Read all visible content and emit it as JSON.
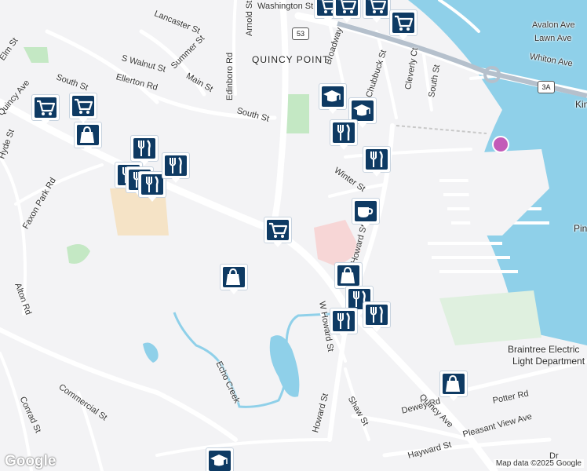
{
  "map": {
    "neighborhood": "QUINCY POINT",
    "route_shields": [
      "53",
      "3A"
    ],
    "streets": [
      "Washington St",
      "Lancaster St",
      "Arnold St",
      "Avalon Ave",
      "Lawn Ave",
      "Whiton Ave",
      "Summer St",
      "S Walnut St",
      "Ellerton Rd",
      "Main St",
      "Edinboro Rd",
      "Broadway",
      "Chubbuck St",
      "Cleverly Ct",
      "South St",
      "South St",
      "South St",
      "Elm St",
      "Quincy Ave",
      "Hyde St",
      "Faxon Park Rd",
      "Winter St",
      "Howard St",
      "W Howard St",
      "Alton Rd",
      "Echo Creek",
      "Commercial St",
      "Conrad St",
      "Shaw St",
      "Howard St",
      "Dewey Rd",
      "Quincy Ave",
      "Potter Rd",
      "Pleasant View Ave",
      "Hayward St",
      "Dr",
      "Kin",
      "Pin"
    ],
    "places": [
      "Braintree Electric",
      "Light Department"
    ],
    "water_color": "#8fd0e9",
    "road_color": "#ffffff",
    "land_color": "#f3f3f5",
    "park_color": "#c4e8c4",
    "marker_color": "#0e3a63"
  },
  "markers": [
    {
      "icon": "shopping-cart-icon"
    },
    {
      "icon": "shopping-cart-icon"
    },
    {
      "icon": "shopping-cart-icon"
    },
    {
      "icon": "shopping-cart-icon"
    },
    {
      "icon": "shopping-cart-icon"
    },
    {
      "icon": "shopping-bag-icon"
    },
    {
      "icon": "shopping-cart-icon"
    },
    {
      "icon": "restaurant-icon"
    },
    {
      "icon": "restaurant-icon"
    },
    {
      "icon": "restaurant-icon"
    },
    {
      "icon": "restaurant-icon"
    },
    {
      "icon": "shopping-cart-icon"
    },
    {
      "icon": "restaurant-icon"
    },
    {
      "icon": "shopping-bag-icon"
    },
    {
      "icon": "school-icon"
    },
    {
      "icon": "school-icon"
    },
    {
      "icon": "restaurant-icon"
    },
    {
      "icon": "restaurant-icon"
    },
    {
      "icon": "cafe-icon"
    },
    {
      "icon": "shopping-bag-icon"
    },
    {
      "icon": "restaurant-icon"
    },
    {
      "icon": "restaurant-icon"
    },
    {
      "icon": "restaurant-icon"
    },
    {
      "icon": "shopping-bag-icon"
    },
    {
      "icon": "school-icon"
    }
  ],
  "footer": {
    "logo": "Google",
    "attribution": "Map data ©2025 Google"
  }
}
